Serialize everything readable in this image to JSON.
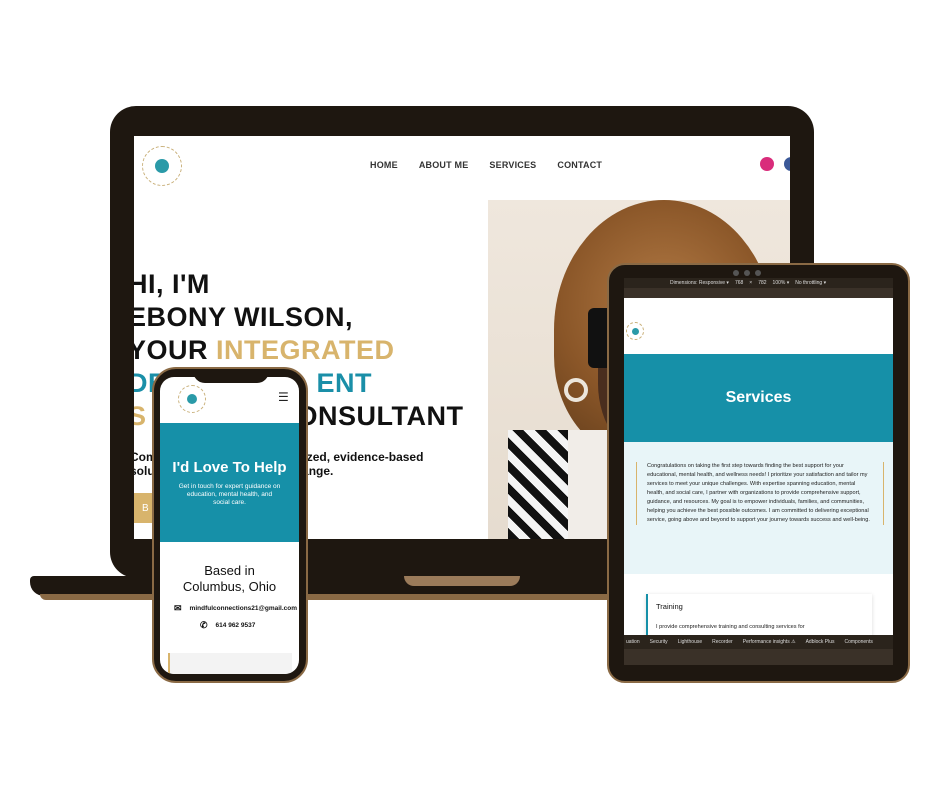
{
  "laptop": {
    "nav": [
      "HOME",
      "ABOUT ME",
      "SERVICES",
      "CONTACT"
    ],
    "hero_lines": {
      "l1": "HI, I'M",
      "l2": "EBONY WILSON,",
      "l3a": "YOUR ",
      "l3b": "INTEGRATED",
      "l4": "DE",
      "l4b": "ENT",
      "l5a": "S",
      "l5b": "ONSULTANT"
    },
    "subtitle_line1": "Com                                         alized, evidence-based",
    "subtitle_line2": "solu                                        change.",
    "button_label": "B"
  },
  "phone": {
    "menu_icon": "☰",
    "hero_title": "I'd Love To Help",
    "hero_text": "Get in touch for expert guidance on education, mental health, and social care.",
    "based_in_line1": "Based in",
    "based_in_line2": "Columbus, Ohio",
    "email": "mindfulconnections21@gmail.com",
    "phone": "614 962 9537"
  },
  "tablet": {
    "devtools_top": [
      "Dimensions: Responsive ▾",
      "768",
      "×",
      "782",
      "100% ▾",
      "No throttling ▾"
    ],
    "banner_title": "Services",
    "intro_text": "Congratulations on taking the first step towards finding the best support for your educational, mental health, and wellness needs! I prioritize your satisfaction and tailor my services to meet your unique challenges. With expertise spanning education, mental health, and social care, I partner with organizations to provide comprehensive support, guidance, and resources. My goal is to empower individuals, families, and communities, helping you achieve the best possible outcomes. I am committed to delivering exceptional service, going above and beyond to support your journey towards success and well-being.",
    "card_title": "Training",
    "card_text": "I provide comprehensive training and consulting services for",
    "devtools_tabs": [
      "uation",
      "Security",
      "Lighthouse",
      "Recorder",
      "Performance insights ⚠",
      "Adblock Plus",
      "Components"
    ]
  },
  "colors": {
    "teal": "#1690a8",
    "gold": "#d8b46c",
    "device_frame": "#1e1710",
    "device_rim": "#8a6a45"
  }
}
